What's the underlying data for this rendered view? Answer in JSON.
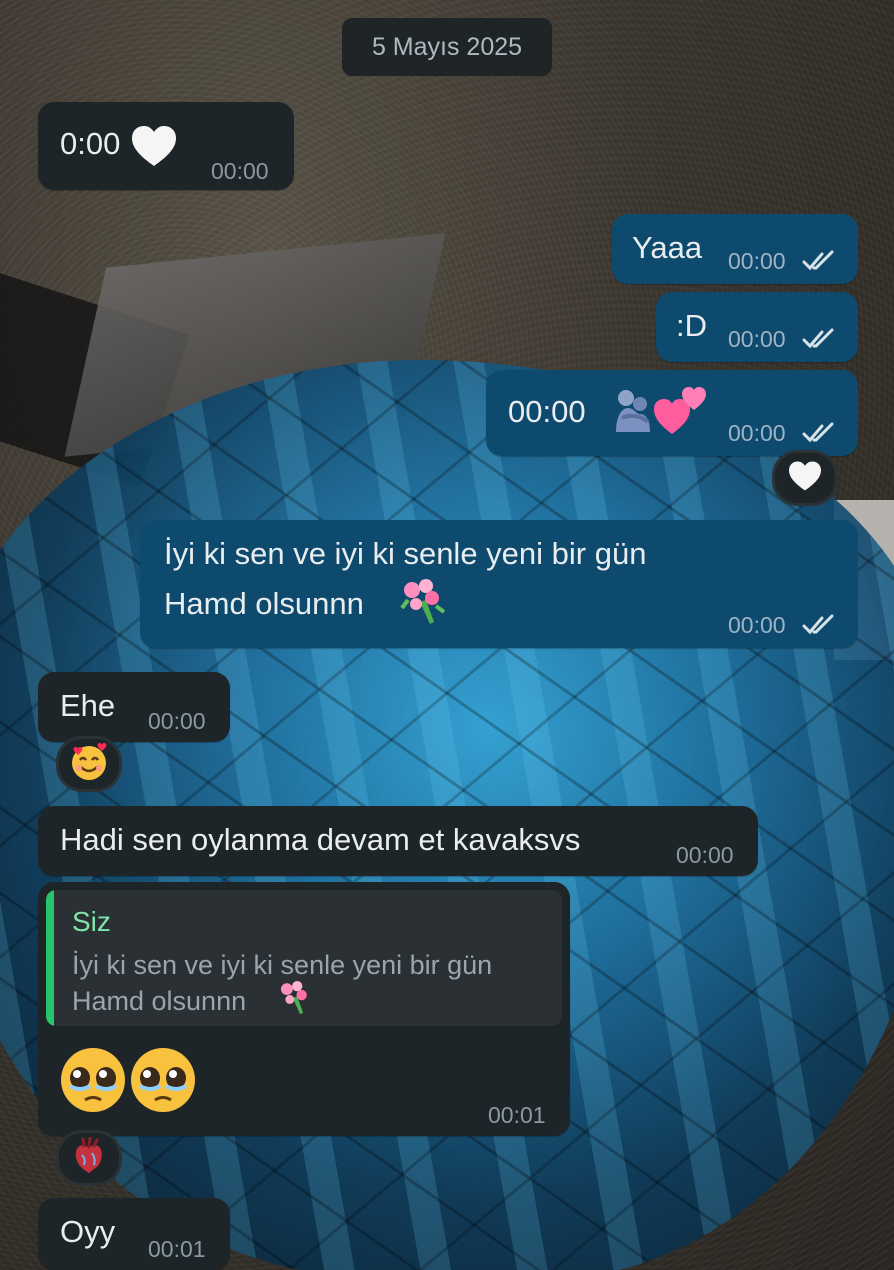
{
  "date_separator": "5 Mayıs 2025",
  "messages": [
    {
      "direction": "incoming",
      "text": "0:00",
      "emoji": "white-heart",
      "time": "00:00"
    },
    {
      "direction": "outgoing",
      "text": "Yaaa",
      "time": "00:00",
      "status": "read"
    },
    {
      "direction": "outgoing",
      "text": ":D",
      "time": "00:00",
      "status": "read"
    },
    {
      "direction": "outgoing",
      "text": "00:00",
      "emoji": [
        "people-hugging",
        "two-hearts"
      ],
      "time": "00:00",
      "status": "read",
      "reaction": "white-heart"
    },
    {
      "direction": "outgoing",
      "lines": [
        "İyi ki sen ve iyi ki senle yeni bir gün",
        "Hamd olsunnn"
      ],
      "emoji": "bouquet",
      "time": "00:00",
      "status": "read"
    },
    {
      "direction": "incoming",
      "text": "Ehe",
      "time": "00:00",
      "reaction": "smiling-face-with-hearts"
    },
    {
      "direction": "incoming",
      "text": "Hadi sen oylanma devam et kavaksvs",
      "time": "00:00"
    },
    {
      "direction": "incoming",
      "reply_to": {
        "author": "Siz",
        "lines": [
          "İyi ki sen ve iyi ki senle yeni bir gün",
          "Hamd olsunnn"
        ],
        "emoji": "bouquet"
      },
      "emoji": [
        "pleading-face",
        "pleading-face"
      ],
      "time": "00:01",
      "reaction": "anatomical-heart"
    },
    {
      "direction": "incoming",
      "text": "Oyy",
      "time": "00:01"
    }
  ],
  "ticks": "✓✓",
  "colors": {
    "incoming_bubble": "#1e2528",
    "outgoing_bubble": "#0e4a6e",
    "reply_accent": "#27c46a",
    "reply_author": "#7fe4a9"
  }
}
